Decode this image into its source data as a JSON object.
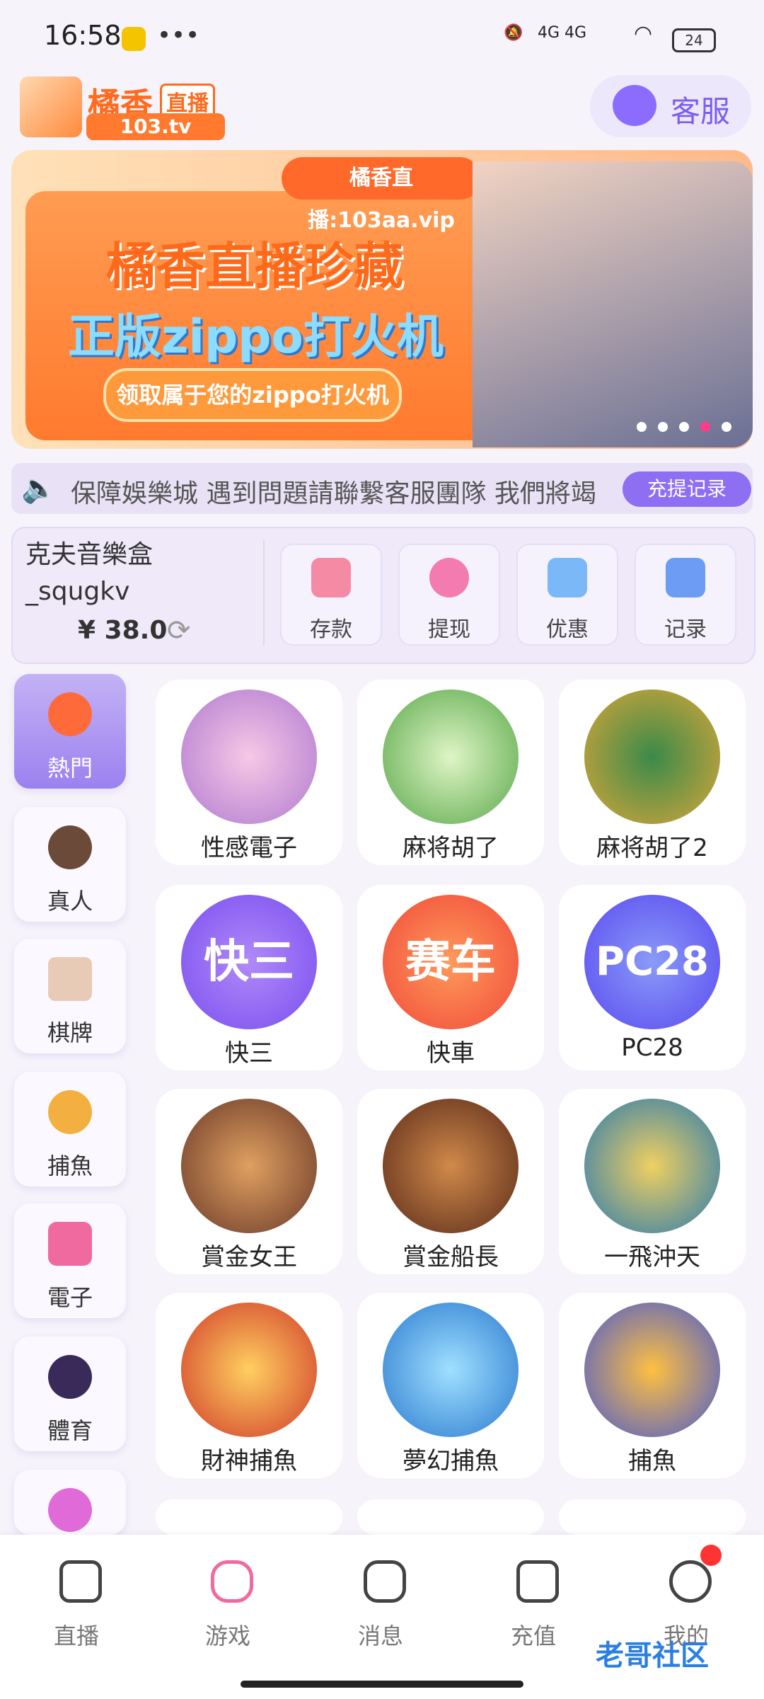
{
  "status_bar": {
    "time": "16:58",
    "dots": "•••",
    "network": "4G 4G",
    "battery": "24"
  },
  "header": {
    "logo_main": "橘香",
    "logo_live": "直播",
    "logo_sub": "103.tv",
    "customer_service": "客服"
  },
  "banner": {
    "top_tag": "橘香直播:103aa.vip",
    "headline_1": "橘香直播珍藏",
    "headline_2": "正版zippo打火机",
    "pill": "领取属于您的zippo打火机",
    "active_dot": 3
  },
  "marquee": {
    "text": "保障娛樂城  遇到問題請聯繫客服團隊  我們將竭",
    "record_button": "充提记录"
  },
  "wallet": {
    "username": "克夫音樂盒_squgkv",
    "balance": "¥ 38.0",
    "actions": [
      {
        "label": "存款",
        "icon": "card-icon",
        "color": "#f58aa5"
      },
      {
        "label": "提现",
        "icon": "money-bag-icon",
        "color": "#f47bb0"
      },
      {
        "label": "优惠",
        "icon": "gift-icon",
        "color": "#7ab8f7"
      },
      {
        "label": "记录",
        "icon": "bar-chart-icon",
        "color": "#6d9cf5"
      }
    ]
  },
  "categories": [
    {
      "label": "熱門",
      "icon": "fire-icon",
      "color": "#ff6a3a",
      "active": true
    },
    {
      "label": "真人",
      "icon": "chip-icon",
      "color": "#6b4a3a",
      "active": false
    },
    {
      "label": "棋牌",
      "icon": "card-icon",
      "color": "#e8cbb6",
      "active": false
    },
    {
      "label": "捕魚",
      "icon": "fish-icon",
      "color": "#f3b040",
      "active": false
    },
    {
      "label": "電子",
      "icon": "slot-machine-icon",
      "color": "#f06aa0",
      "active": false
    },
    {
      "label": "體育",
      "icon": "soccer-ball-icon",
      "color": "#5a3ad0",
      "active": false
    },
    {
      "label": "",
      "icon": "lottery-ball-icon",
      "color": "#e06ad8",
      "active": false
    }
  ],
  "games": [
    {
      "label": "性感電子",
      "color": "#e6b0d6",
      "text": ""
    },
    {
      "label": "麻将胡了",
      "color": "#9ad36a",
      "text": ""
    },
    {
      "label": "麻将胡了2",
      "color": "#d9a63a",
      "text": ""
    },
    {
      "label": "快三",
      "color": "#8a5cf0",
      "text": "快三"
    },
    {
      "label": "快車",
      "color": "#f06a3a",
      "text": "赛车"
    },
    {
      "label": "PC28",
      "color": "#6a6af5",
      "text": "PC28"
    },
    {
      "label": "賞金女王",
      "color": "#b0703a",
      "text": ""
    },
    {
      "label": "賞金船長",
      "color": "#9a5a3a",
      "text": ""
    },
    {
      "label": "一飛沖天",
      "color": "#5ab0e0",
      "text": ""
    },
    {
      "label": "財神捕魚",
      "color": "#e05a4a",
      "text": ""
    },
    {
      "label": "夢幻捕魚",
      "color": "#4aa0e0",
      "text": ""
    },
    {
      "label": "捕魚",
      "color": "#5a7af0",
      "text": ""
    }
  ],
  "bottom_nav": [
    {
      "label": "直播",
      "icon": "video-icon"
    },
    {
      "label": "游戏",
      "icon": "gamepad-icon"
    },
    {
      "label": "消息",
      "icon": "message-icon"
    },
    {
      "label": "充值",
      "icon": "wallet-icon"
    },
    {
      "label": "我的",
      "icon": "profile-icon"
    }
  ],
  "watermark": "老哥社区"
}
